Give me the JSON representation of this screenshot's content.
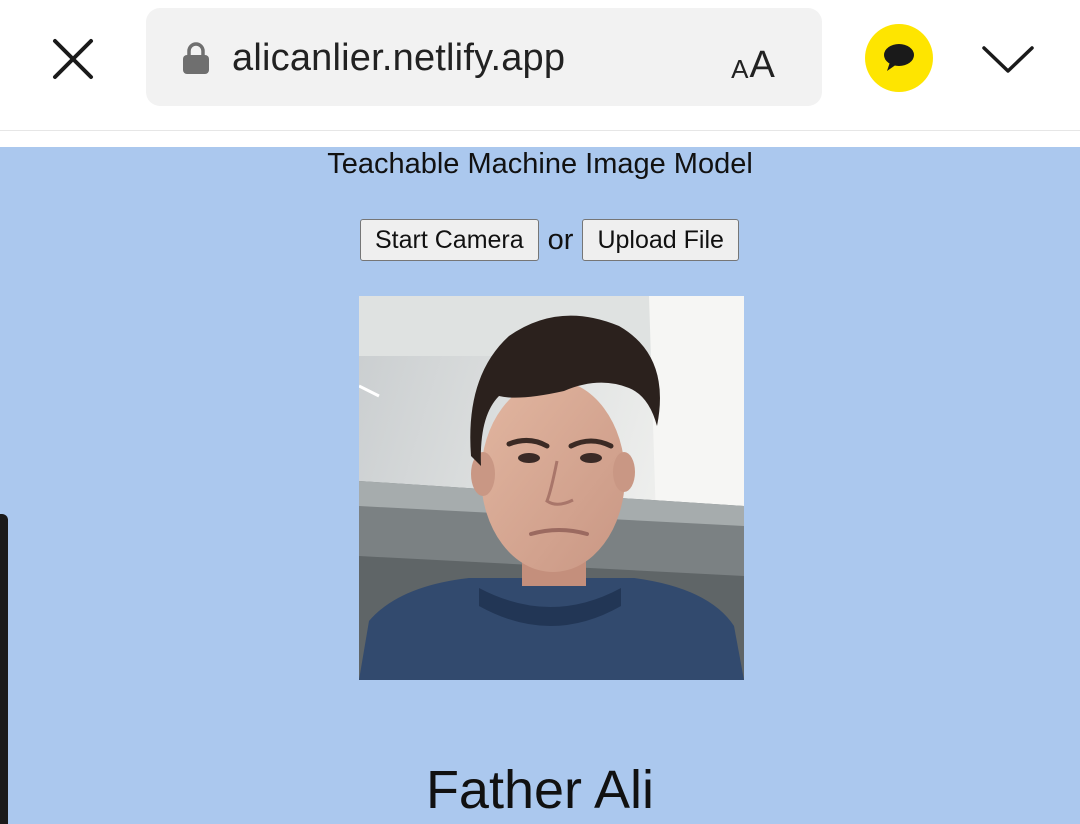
{
  "browser": {
    "url": "alicanlier.netlify.app",
    "text_size_small": "A",
    "text_size_large": "A",
    "icons": {
      "close": "close-icon",
      "lock": "lock-icon",
      "talk": "speech-bubble-icon",
      "more": "chevron-down-icon"
    },
    "colors": {
      "talk_button": "#fee500",
      "page_background": "#abc8ee"
    }
  },
  "page": {
    "heading": "Teachable Machine Image Model",
    "start_camera_label": "Start Camera",
    "or_label": "or",
    "upload_file_label": "Upload File",
    "prediction_label": "Father Ali"
  }
}
